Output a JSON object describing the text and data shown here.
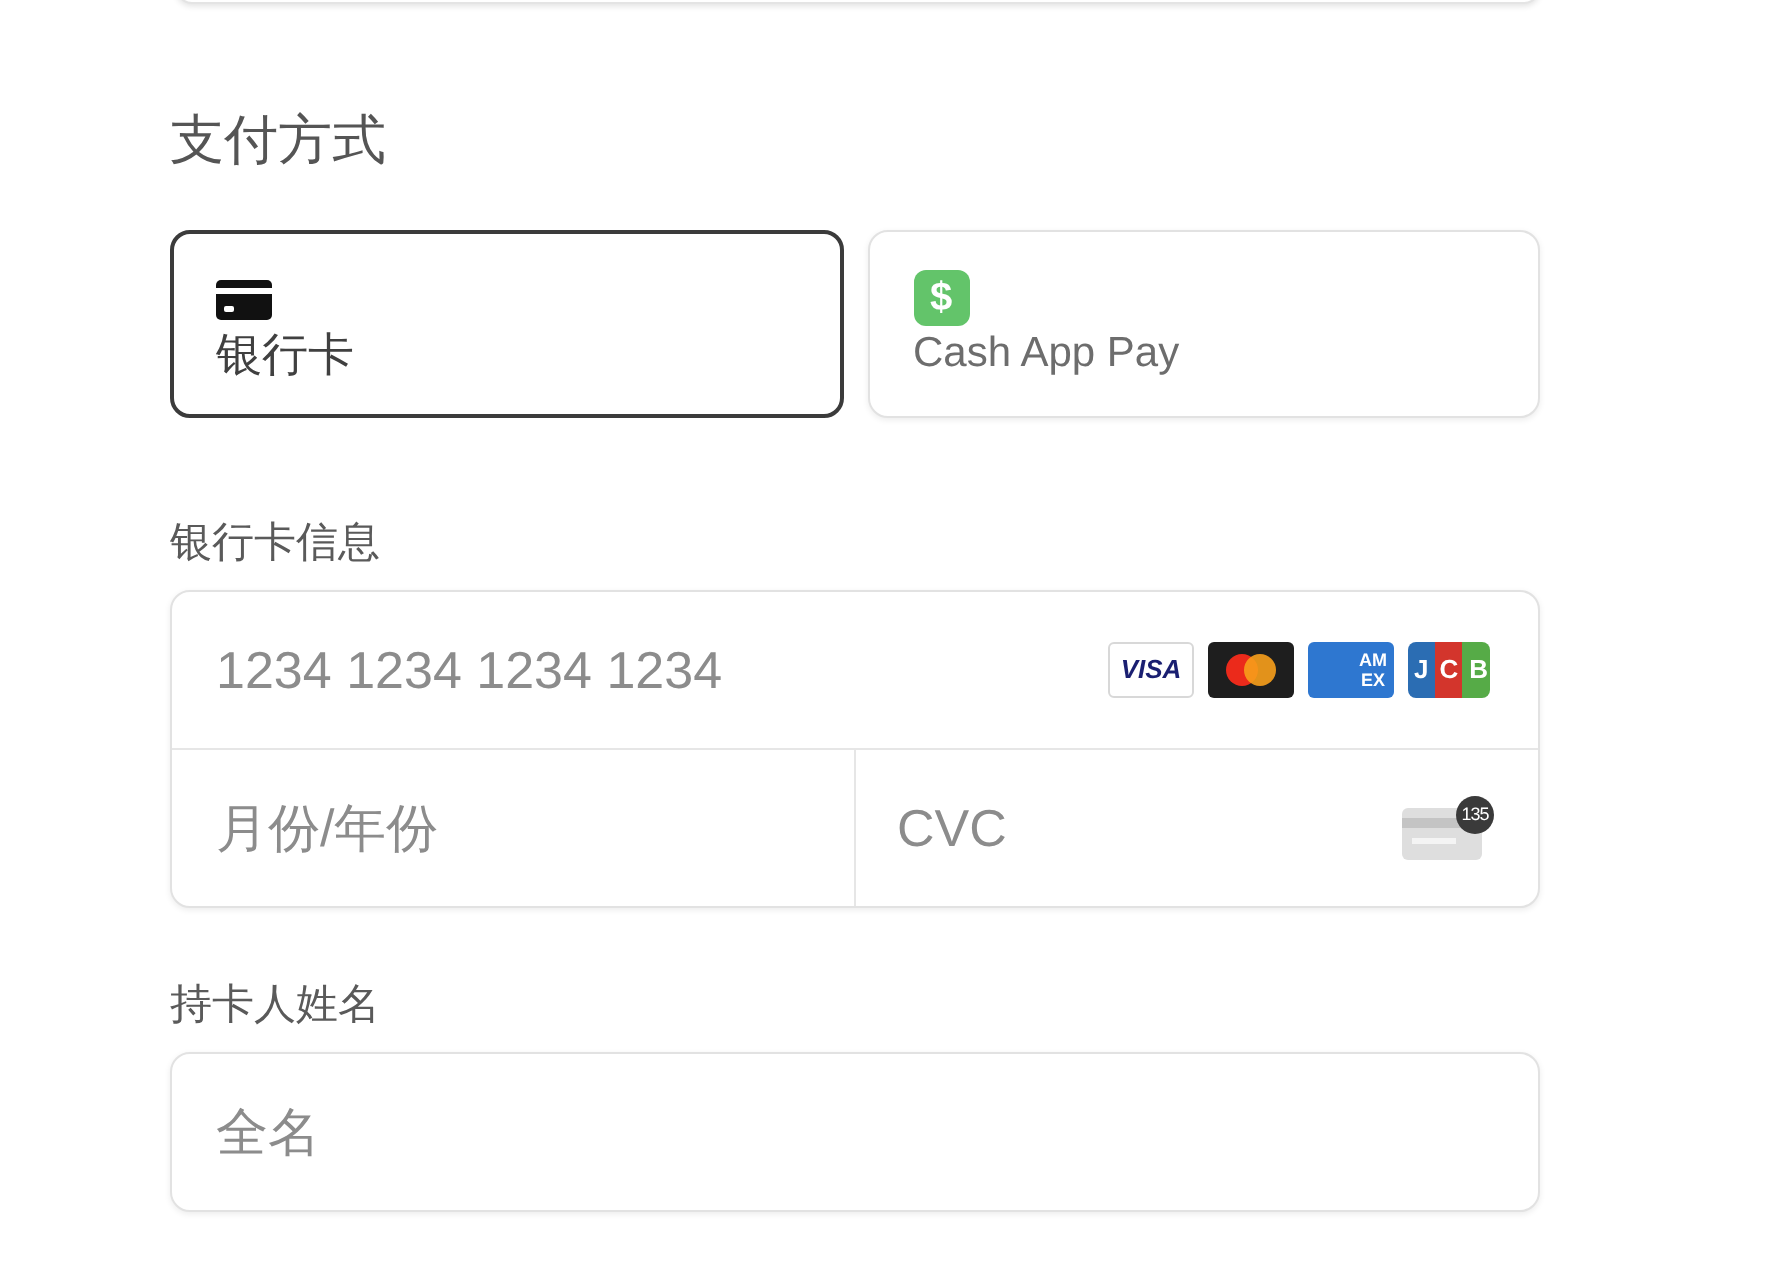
{
  "payment_method": {
    "title": "支付方式",
    "options": [
      {
        "kind": "card",
        "label": "银行卡",
        "selected": true
      },
      {
        "kind": "cash_app",
        "icon": "$",
        "label": "Cash App Pay",
        "selected": false
      }
    ]
  },
  "card_details": {
    "label": "银行卡信息",
    "card_number": {
      "placeholder": "1234 1234 1234 1234",
      "brands": [
        {
          "kind": "visa",
          "text": "VISA"
        },
        {
          "kind": "mastercard"
        },
        {
          "kind": "amex",
          "text": "AMEX"
        },
        {
          "kind": "jcb",
          "text": "JCB"
        }
      ]
    },
    "expiry": {
      "placeholder": "月份/年份"
    },
    "cvc": {
      "placeholder": "CVC",
      "hint": "135"
    }
  },
  "cardholder": {
    "label": "持卡人姓名",
    "placeholder": "全名"
  }
}
